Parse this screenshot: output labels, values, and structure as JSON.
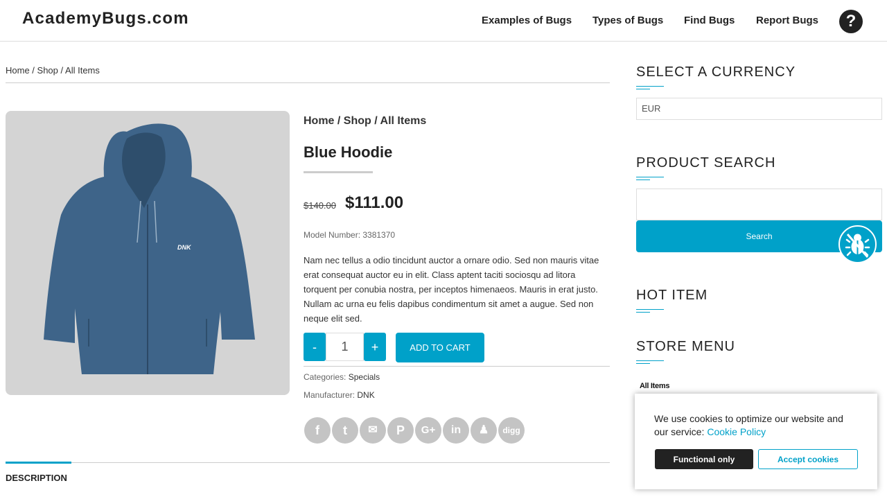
{
  "header": {
    "logo": "AcademyBugs.com",
    "nav": [
      "Examples of Bugs",
      "Types of Bugs",
      "Find Bugs",
      "Report Bugs"
    ],
    "help_icon": "question-circle-icon"
  },
  "breadcrumb": {
    "home": "Home",
    "sep": " / ",
    "shop": "Shop",
    "current": "All Items"
  },
  "product": {
    "breadcrumb": "Home / Shop / All Items",
    "title": "Blue Hoodie",
    "old_price": "$140.00",
    "price": "$111.00",
    "model": "Model Number: 3381370",
    "description": "Nam nec tellus a odio tincidunt auctor a ornare odio. Sed non mauris vitae erat consequat auctor eu in elit. Class aptent taciti sociosqu ad litora torquent per conubia nostra, per inceptos himenaeos. Mauris in erat justo. Nullam ac urna eu felis dapibus condimentum sit amet a augue. Sed non neque elit sed.",
    "qty_minus": "-",
    "qty": "1",
    "qty_plus": "+",
    "add_to_cart": "ADD TO CART",
    "categories_label": "Categories:",
    "category": "Specials",
    "manufacturer_label": "Manufacturer:",
    "manufacturer": "DNK",
    "image_logo": "DNK",
    "hoodie_color": "#3e6489"
  },
  "share": [
    "facebook",
    "twitter",
    "email",
    "pinterest",
    "google-plus",
    "linkedin",
    "myspace",
    "digg"
  ],
  "tabs": {
    "description": "DESCRIPTION"
  },
  "sidebar": {
    "currency_heading": "SELECT A CURRENCY",
    "currency_value": "EUR",
    "search_heading": "PRODUCT SEARCH",
    "search_button": "Search",
    "hot_heading": "HOT ITEM",
    "store_heading": "STORE MENU",
    "store_item": "All Items"
  },
  "cookie": {
    "text": "We use cookies to optimize our website and our service:",
    "link": "Cookie Policy",
    "functional": "Functional only",
    "accept": "Accept cookies"
  },
  "colors": {
    "accent": "#00a1c9",
    "dark": "#222222"
  }
}
